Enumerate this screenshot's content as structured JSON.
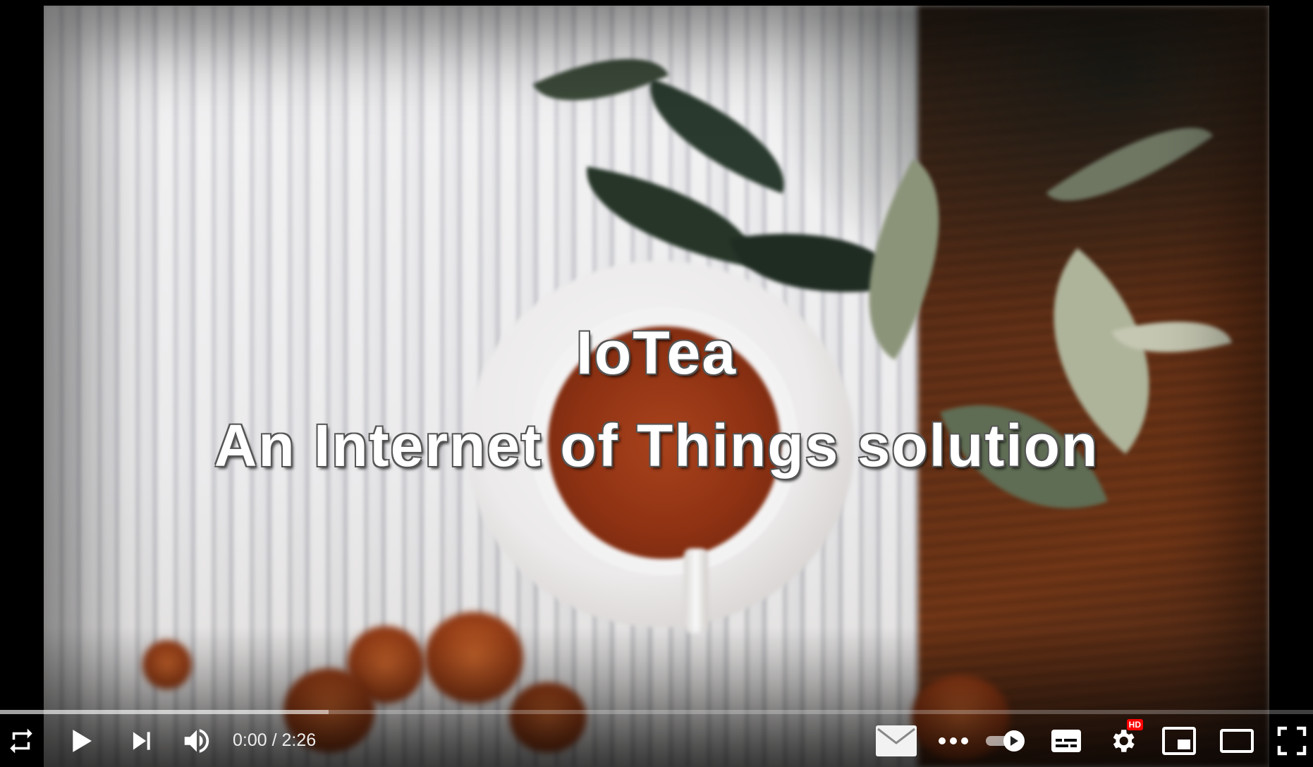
{
  "video": {
    "title_line1": "IoTea",
    "title_line2": "An Internet of Things solution"
  },
  "playback": {
    "current_time": "0:00",
    "separator": " / ",
    "duration": "2:26",
    "played_fraction": 0.0,
    "buffered_fraction": 0.25,
    "state": "paused"
  },
  "controls": {
    "left": [
      {
        "name": "loop-icon",
        "label": "Loop"
      },
      {
        "name": "play-icon",
        "label": "Play"
      },
      {
        "name": "next-icon",
        "label": "Next"
      },
      {
        "name": "volume-icon",
        "label": "Mute"
      }
    ],
    "right": [
      {
        "name": "mail-icon",
        "label": "Share via email"
      },
      {
        "name": "more-icon",
        "label": "More"
      },
      {
        "name": "autoplay-toggle-icon",
        "label": "Autoplay"
      },
      {
        "name": "subtitles-icon",
        "label": "Subtitles/closed captions"
      },
      {
        "name": "settings-icon",
        "label": "Settings"
      },
      {
        "name": "miniplayer-icon",
        "label": "Miniplayer"
      },
      {
        "name": "theater-mode-icon",
        "label": "Theater mode"
      },
      {
        "name": "fullscreen-icon",
        "label": "Full screen"
      }
    ],
    "quality_badge": "HD"
  },
  "colors": {
    "progress_played": "#ff0000",
    "hd_badge": "#ff0000",
    "controls_foreground": "#ffffff"
  }
}
